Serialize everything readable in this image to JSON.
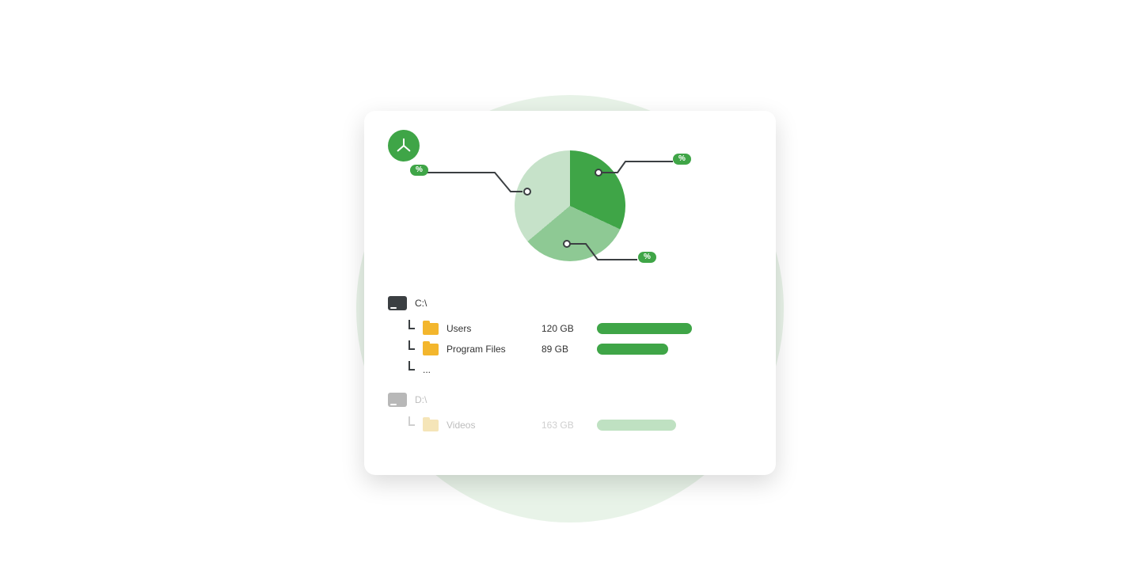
{
  "chart_data": {
    "type": "pie",
    "title": "",
    "series": [
      {
        "name": "slice-1",
        "value": 33,
        "label": "%"
      },
      {
        "name": "slice-2",
        "value": 33,
        "label": "%"
      },
      {
        "name": "slice-3",
        "value": 34,
        "label": "%"
      }
    ]
  },
  "drives": [
    {
      "label": "C:\\",
      "dim": false,
      "children": [
        {
          "name": "Users",
          "size": "120 GB",
          "bar": 120
        },
        {
          "name": "Program Files",
          "size": "89 GB",
          "bar": 89
        },
        {
          "name": "...",
          "size": "",
          "bar": 0
        }
      ]
    },
    {
      "label": "D:\\",
      "dim": true,
      "children": [
        {
          "name": "Videos",
          "size": "163 GB",
          "bar": 100
        }
      ]
    }
  ],
  "colors": {
    "accent": "#3fa547",
    "accent_light": "#8ec994",
    "accent_lighter": "#c6e2c9",
    "folder": "#f3b62d"
  }
}
